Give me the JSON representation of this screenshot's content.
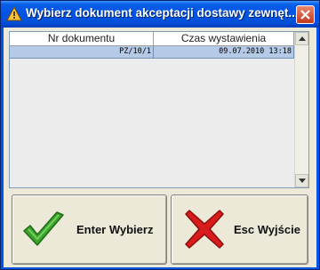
{
  "window": {
    "title": "Wybierz dokument akceptacji dostawy zewnęt..."
  },
  "table": {
    "columns": [
      "Nr dokumentu",
      "Czas wystawienia"
    ],
    "rows": [
      {
        "nr": "PZ/10/1",
        "czas": "09.07.2010 13:18"
      }
    ]
  },
  "buttons": {
    "select_label": "Enter Wybierz",
    "exit_label": "Esc Wyjście"
  },
  "colors": {
    "title_bar": "#0054e3",
    "selected_row": "#b4cae6",
    "check": "#3aa52a",
    "cross": "#d81c1c"
  }
}
